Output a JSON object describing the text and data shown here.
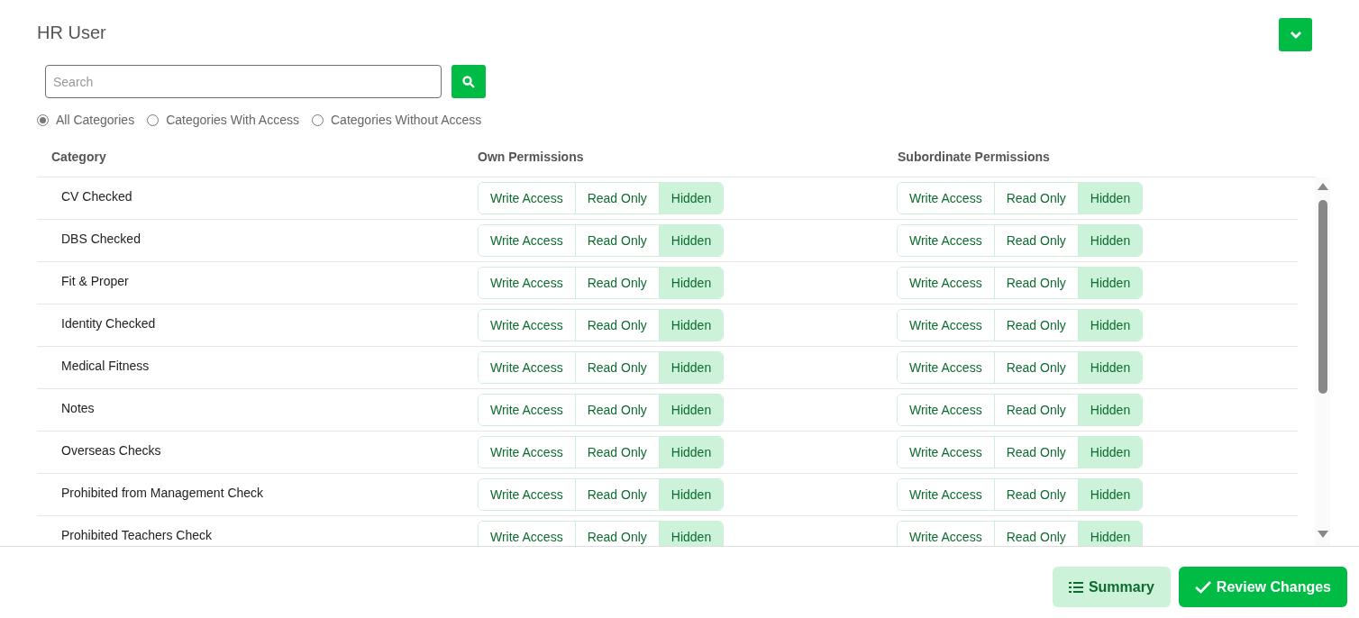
{
  "title": "HR User",
  "search": {
    "placeholder": "Search"
  },
  "filters": [
    {
      "label": "All Categories",
      "selected": true
    },
    {
      "label": "Categories With Access",
      "selected": false
    },
    {
      "label": "Categories Without Access",
      "selected": false
    }
  ],
  "table": {
    "columns": [
      "Category",
      "Own Permissions",
      "Subordinate Permissions"
    ],
    "rows": [
      {
        "category": "CV Checked",
        "own": [
          {
            "label": "Write Access",
            "selected": false
          },
          {
            "label": "Read Only",
            "selected": false
          },
          {
            "label": "Hidden",
            "selected": true
          }
        ],
        "subordinate": [
          {
            "label": "Write Access",
            "selected": false
          },
          {
            "label": "Read Only",
            "selected": false
          },
          {
            "label": "Hidden",
            "selected": true
          }
        ]
      },
      {
        "category": "DBS Checked",
        "own": [
          {
            "label": "Write Access",
            "selected": false
          },
          {
            "label": "Read Only",
            "selected": false
          },
          {
            "label": "Hidden",
            "selected": true
          }
        ],
        "subordinate": [
          {
            "label": "Write Access",
            "selected": false
          },
          {
            "label": "Read Only",
            "selected": false
          },
          {
            "label": "Hidden",
            "selected": true
          }
        ]
      },
      {
        "category": "Fit & Proper",
        "own": [
          {
            "label": "Write Access",
            "selected": false
          },
          {
            "label": "Read Only",
            "selected": false
          },
          {
            "label": "Hidden",
            "selected": true
          }
        ],
        "subordinate": [
          {
            "label": "Write Access",
            "selected": false
          },
          {
            "label": "Read Only",
            "selected": false
          },
          {
            "label": "Hidden",
            "selected": true
          }
        ]
      },
      {
        "category": "Identity Checked",
        "own": [
          {
            "label": "Write Access",
            "selected": false
          },
          {
            "label": "Read Only",
            "selected": false
          },
          {
            "label": "Hidden",
            "selected": true
          }
        ],
        "subordinate": [
          {
            "label": "Write Access",
            "selected": false
          },
          {
            "label": "Read Only",
            "selected": false
          },
          {
            "label": "Hidden",
            "selected": true
          }
        ]
      },
      {
        "category": "Medical Fitness",
        "own": [
          {
            "label": "Write Access",
            "selected": false
          },
          {
            "label": "Read Only",
            "selected": false
          },
          {
            "label": "Hidden",
            "selected": true
          }
        ],
        "subordinate": [
          {
            "label": "Write Access",
            "selected": false
          },
          {
            "label": "Read Only",
            "selected": false
          },
          {
            "label": "Hidden",
            "selected": true
          }
        ]
      },
      {
        "category": "Notes",
        "own": [
          {
            "label": "Write Access",
            "selected": false
          },
          {
            "label": "Read Only",
            "selected": false
          },
          {
            "label": "Hidden",
            "selected": true
          }
        ],
        "subordinate": [
          {
            "label": "Write Access",
            "selected": false
          },
          {
            "label": "Read Only",
            "selected": false
          },
          {
            "label": "Hidden",
            "selected": true
          }
        ]
      },
      {
        "category": "Overseas Checks",
        "own": [
          {
            "label": "Write Access",
            "selected": false
          },
          {
            "label": "Read Only",
            "selected": false
          },
          {
            "label": "Hidden",
            "selected": true
          }
        ],
        "subordinate": [
          {
            "label": "Write Access",
            "selected": false
          },
          {
            "label": "Read Only",
            "selected": false
          },
          {
            "label": "Hidden",
            "selected": true
          }
        ]
      },
      {
        "category": "Prohibited from Management Check",
        "own": [
          {
            "label": "Write Access",
            "selected": false
          },
          {
            "label": "Read Only",
            "selected": false
          },
          {
            "label": "Hidden",
            "selected": true
          }
        ],
        "subordinate": [
          {
            "label": "Write Access",
            "selected": false
          },
          {
            "label": "Read Only",
            "selected": false
          },
          {
            "label": "Hidden",
            "selected": true
          }
        ]
      },
      {
        "category": "Prohibited Teachers Check",
        "own": [
          {
            "label": "Write Access",
            "selected": false
          },
          {
            "label": "Read Only",
            "selected": false
          },
          {
            "label": "Hidden",
            "selected": true
          }
        ],
        "subordinate": [
          {
            "label": "Write Access",
            "selected": false
          },
          {
            "label": "Read Only",
            "selected": false
          },
          {
            "label": "Hidden",
            "selected": true
          }
        ]
      }
    ]
  },
  "buttons": [
    {
      "label": "Summary",
      "kind": "secondary"
    },
    {
      "label": "Review Changes",
      "kind": "primary"
    }
  ]
}
